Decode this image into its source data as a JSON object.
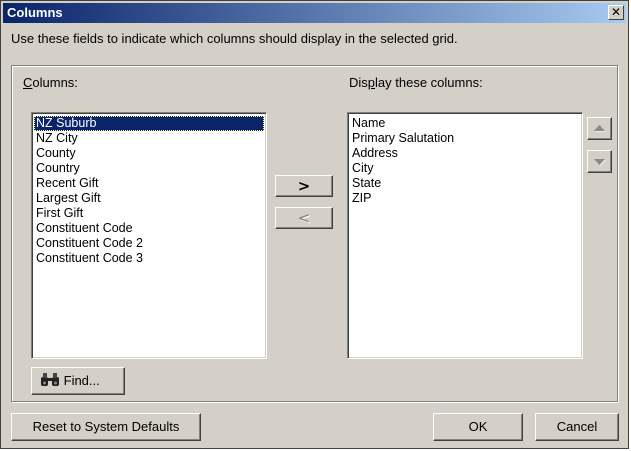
{
  "dialog": {
    "title": "Columns",
    "close_glyph": "✕",
    "instruction": "Use these fields to indicate which columns should display in the selected grid."
  },
  "available": {
    "label_prefix": "",
    "label_accel": "C",
    "label_rest": "olumns:",
    "items": [
      "NZ Suburb",
      "NZ City",
      "County",
      "Country",
      "Recent Gift",
      "Largest Gift",
      "First Gift",
      "Constituent Code",
      "Constituent Code 2",
      "Constituent Code 3"
    ],
    "selected_index": 0
  },
  "display": {
    "label_prefix": "Dis",
    "label_accel": "p",
    "label_rest": "lay these columns:",
    "items": [
      "Name",
      "Primary Salutation",
      "Address",
      "City",
      "State",
      "ZIP"
    ]
  },
  "buttons": {
    "add": ">",
    "remove": "<",
    "move_up_icon": "arrow-up-icon",
    "move_down_icon": "arrow-down-icon",
    "find_label": "Find...",
    "find_icon": "binoculars-icon",
    "reset_label": "Reset to System Defaults",
    "ok_label": "OK",
    "cancel_label": "Cancel"
  },
  "colors": {
    "title_bar": "#0a246a",
    "selection": "#0a246a",
    "face": "#d4d0c8"
  }
}
